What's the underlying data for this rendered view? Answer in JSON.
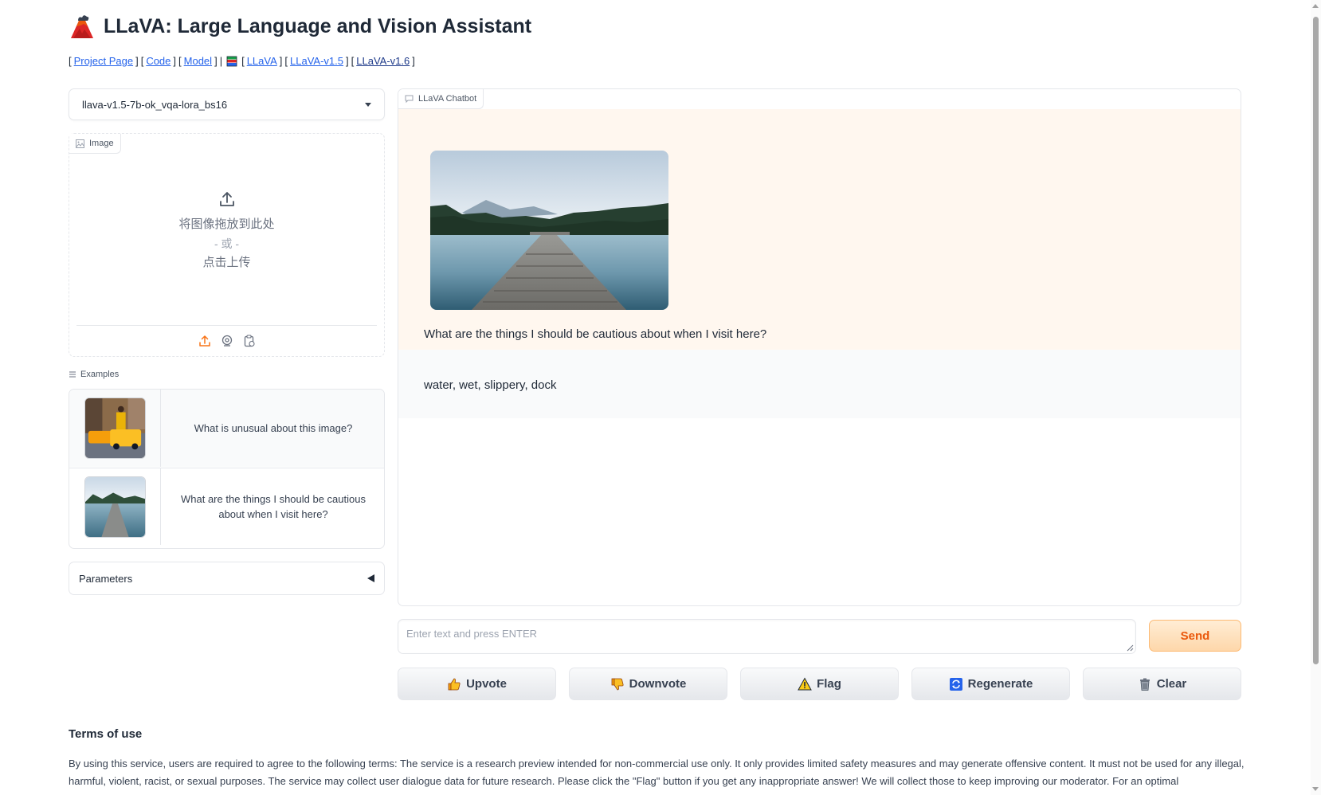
{
  "header": {
    "logo_icon": "volcano-icon",
    "title": "LLaVA: Large Language and Vision Assistant"
  },
  "links": {
    "open_bracket": "[",
    "close_bracket": "]",
    "separator": "|",
    "project_page": "Project Page",
    "code": "Code",
    "model": "Model",
    "books_icon": "books-icon",
    "llava": "LLaVA",
    "llava_v15": "LLaVA-v1.5",
    "llava_v16": "LLaVA-v1.6"
  },
  "model_select": {
    "value": "llava-v1.5-7b-ok_vqa-lora_bs16"
  },
  "image_upload": {
    "label": "Image",
    "drop_text": "将图像拖放到此处",
    "or_text": "- 或 -",
    "click_text": "点击上传",
    "tools": [
      "upload-icon",
      "webcam-icon",
      "clipboard-icon"
    ]
  },
  "examples": {
    "label": "Examples",
    "items": [
      {
        "thumbnail": "taxi-ironing-thumbnail",
        "text": "What is unusual about this image?"
      },
      {
        "thumbnail": "lake-dock-thumbnail",
        "text": "What are the things I should be cautious about when I visit here?"
      }
    ]
  },
  "parameters": {
    "label": "Parameters"
  },
  "chatbot": {
    "label": "LLaVA Chatbot",
    "messages": [
      {
        "role": "user",
        "image": "lake-dock-image",
        "text": "What are the things I should be cautious about when I visit here?"
      },
      {
        "role": "assistant",
        "text": "water, wet, slippery, dock"
      }
    ]
  },
  "input": {
    "placeholder": "Enter text and press ENTER",
    "value": ""
  },
  "buttons": {
    "send": "Send",
    "upvote": "Upvote",
    "downvote": "Downvote",
    "flag": "Flag",
    "regenerate": "Regenerate",
    "clear": "Clear"
  },
  "terms": {
    "title": "Terms of use",
    "text": "By using this service, users are required to agree to the following terms: The service is a research preview intended for non-commercial use only. It only provides limited safety measures and may generate offensive content. It must not be used for any illegal, harmful, violent, racist, or sexual purposes. The service may collect user dialogue data for future research. Please click the \"Flag\" button if you get any inappropriate answer! We will collect those to keep improving our moderator. For an optimal"
  },
  "colors": {
    "accent": "#ea580c",
    "user_bubble": "#fff7ef",
    "bot_bubble": "#f9fafb",
    "link": "#2563eb"
  }
}
